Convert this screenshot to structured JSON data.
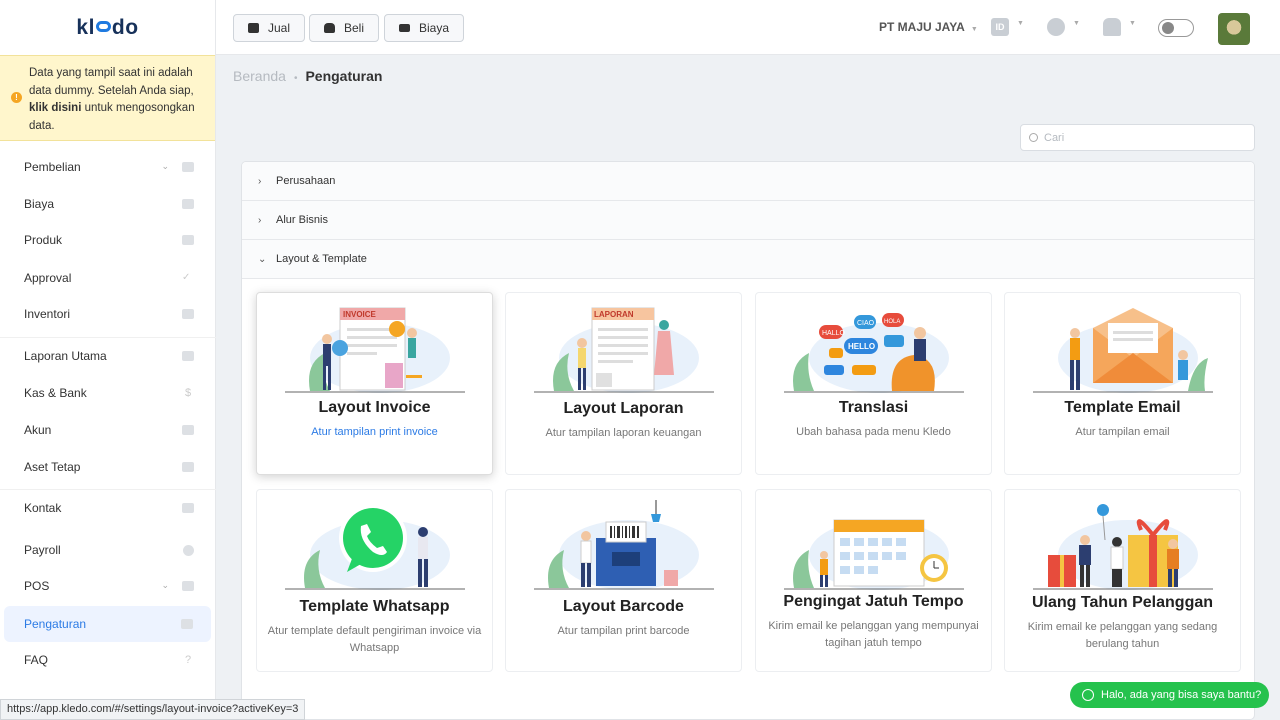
{
  "app": {
    "logo": "kledo"
  },
  "notice": {
    "text_before": "Data yang tampil saat ini adalah data dummy. Setelah Anda siap, ",
    "link": "klik disini",
    "text_after": " untuk mengosongkan data."
  },
  "sidebar": {
    "items": [
      {
        "label": "Pembelian",
        "icon": "bag-icon",
        "chevron": true
      },
      {
        "label": "Biaya",
        "icon": "card-icon"
      },
      {
        "label": "Produk",
        "icon": "box-icon"
      },
      {
        "label": "Approval",
        "icon": "check-icon"
      },
      {
        "label": "Inventori",
        "icon": "warehouse-icon"
      },
      {
        "label": "Laporan Utama",
        "icon": "chart-icon"
      },
      {
        "label": "Kas & Bank",
        "icon": "dollar-icon"
      },
      {
        "label": "Akun",
        "icon": "ledger-icon"
      },
      {
        "label": "Aset Tetap",
        "icon": "building-icon"
      },
      {
        "label": "Kontak",
        "icon": "contact-icon"
      },
      {
        "label": "Payroll",
        "icon": "payroll-icon"
      },
      {
        "label": "POS",
        "icon": "pos-icon",
        "chevron": true
      },
      {
        "label": "Pengaturan",
        "icon": "gears-icon",
        "active": true
      },
      {
        "label": "FAQ",
        "icon": "question-icon"
      }
    ]
  },
  "topbar": {
    "buttons": [
      {
        "label": "Jual",
        "icon": "basket-icon"
      },
      {
        "label": "Beli",
        "icon": "bag-icon"
      },
      {
        "label": "Biaya",
        "icon": "wallet-icon"
      }
    ],
    "company": "PT MAJU JAYA",
    "language": "ID"
  },
  "breadcrumb": {
    "home": "Beranda",
    "current": "Pengaturan"
  },
  "search": {
    "placeholder": "Cari",
    "value": ""
  },
  "accordion": [
    {
      "label": "Perusahaan",
      "expanded": false
    },
    {
      "label": "Alur Bisnis",
      "expanded": false
    },
    {
      "label": "Layout & Template",
      "expanded": true
    }
  ],
  "cards": [
    {
      "title": "Layout Invoice",
      "desc": "Atur tampilan print invoice",
      "hover": true
    },
    {
      "title": "Layout Laporan",
      "desc": "Atur tampilan laporan keuangan"
    },
    {
      "title": "Translasi",
      "desc": "Ubah bahasa pada menu Kledo"
    },
    {
      "title": "Template Email",
      "desc": "Atur tampilan email"
    },
    {
      "title": "Template Whatsapp",
      "desc": "Atur template default pengiriman invoice via Whatsapp"
    },
    {
      "title": "Layout Barcode",
      "desc": "Atur tampilan print barcode"
    },
    {
      "title": "Pengingat Jatuh Tempo",
      "desc": "Kirim email ke pelanggan yang mempunyai tagihan jatuh tempo"
    },
    {
      "title": "Ulang Tahun Pelanggan",
      "desc": "Kirim email ke pelanggan yang sedang berulang tahun"
    }
  ],
  "illus_text": {
    "invoice": "INVOICE",
    "laporan": "LAPORAN",
    "hallo": "HALLO",
    "ciao": "CIAO",
    "hola": "HOLA",
    "hello": "HELLO"
  },
  "statusbar": {
    "url": "https://app.kledo.com/#/settings/layout-invoice?activeKey=3"
  },
  "whatsapp_help": "Halo, ada yang bisa saya bantu?"
}
